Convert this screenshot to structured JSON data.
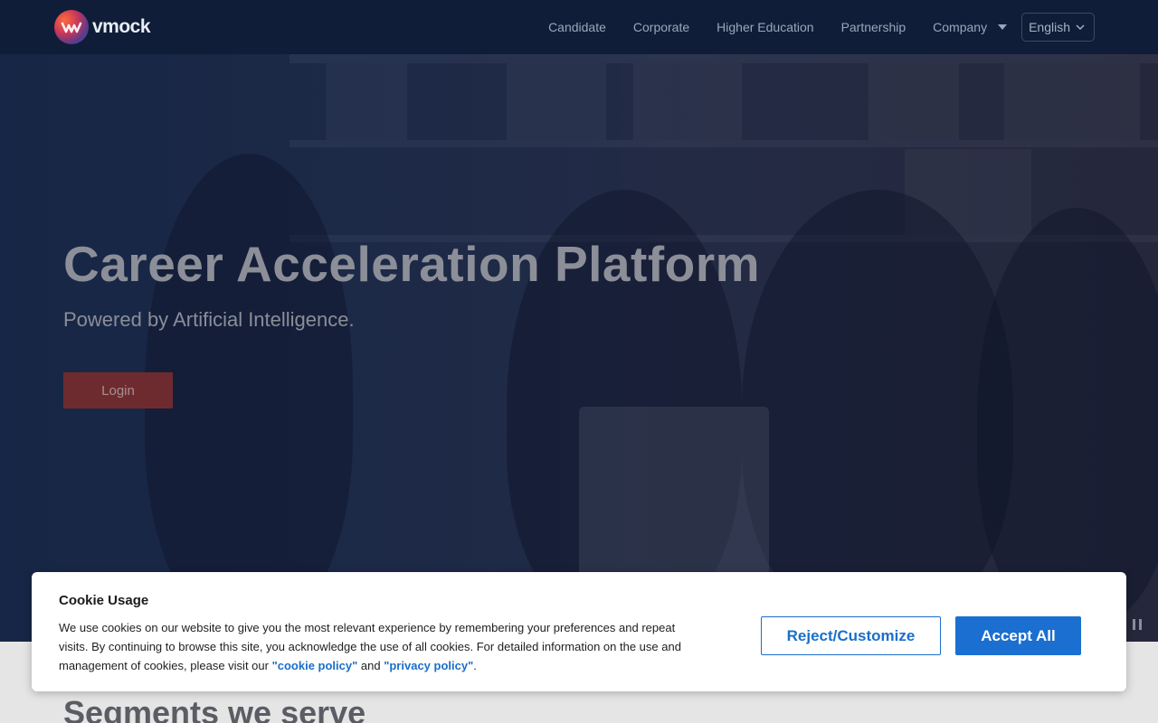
{
  "header": {
    "logo_text": "vmock",
    "nav": [
      {
        "label": "Candidate"
      },
      {
        "label": "Corporate"
      },
      {
        "label": "Higher Education"
      },
      {
        "label": "Partnership"
      },
      {
        "label": "Company"
      }
    ],
    "language": "English"
  },
  "hero": {
    "title": "Career Acceleration Platform",
    "subtitle": "Powered by Artificial Intelligence.",
    "login_label": "Login"
  },
  "segments": {
    "title": "Segments we serve"
  },
  "cookie": {
    "title": "Cookie Usage",
    "text_part1": "We use cookies on our website to give you the most relevant experience by remembering your preferences and repeat visits. By continuing to browse this site, you acknowledge the use of all cookies. For detailed information on the use and management of cookies, please visit our ",
    "cookie_policy_link": "\"cookie policy\"",
    "text_and": " and ",
    "privacy_policy_link": "\"privacy policy\"",
    "text_end": ".",
    "reject_label": "Reject/Customize",
    "accept_label": "Accept All"
  },
  "colors": {
    "header_bg": "#0f1d38",
    "accent_blue": "#1a6fd0",
    "login_red": "#6e2b2f"
  }
}
